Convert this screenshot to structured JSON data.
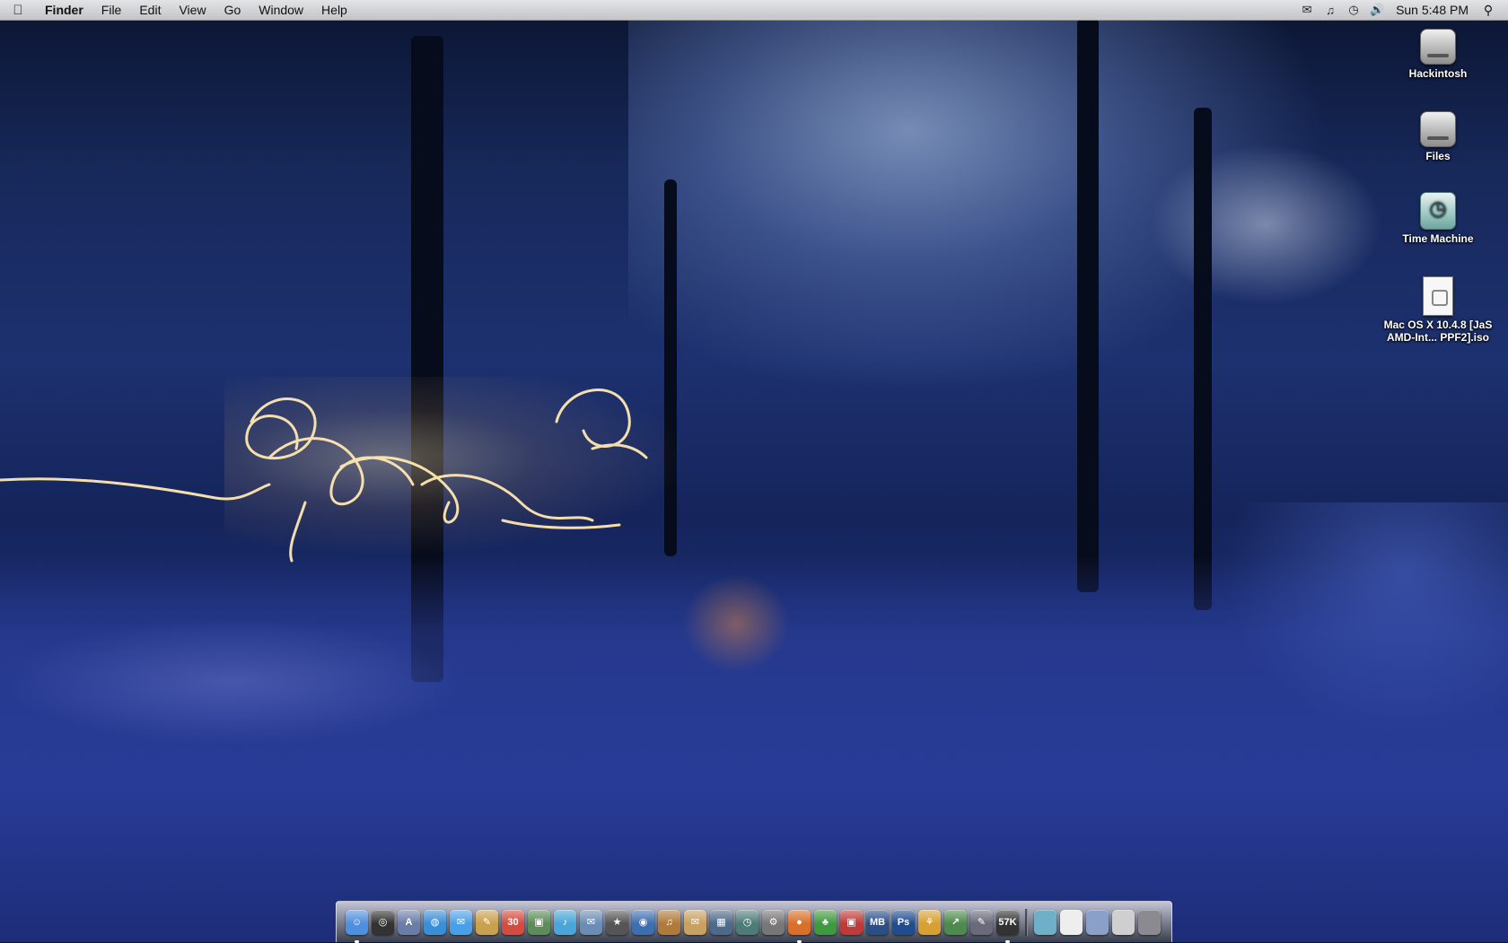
{
  "menubar": {
    "app_name": "Finder",
    "menus": [
      "File",
      "Edit",
      "View",
      "Go",
      "Window",
      "Help"
    ],
    "clock": "Sun 5:48 PM",
    "extras": [
      "mail-icon",
      "music-note-icon",
      "time-machine-icon",
      "volume-icon"
    ],
    "spotlight_icon": "spotlight-icon"
  },
  "desktop": {
    "icons": [
      {
        "label": "Hackintosh",
        "type": "disk"
      },
      {
        "label": "Files",
        "type": "disk"
      },
      {
        "label": "Time Machine",
        "type": "time-machine"
      },
      {
        "label": "Mac OS X 10.4.8 [JaS AMD-Int... PPF2].iso",
        "type": "iso"
      }
    ]
  },
  "dock": {
    "glyphs": [
      "☺",
      "◎",
      "A",
      "◍",
      "✉",
      "✎",
      "30",
      "▣",
      "♪",
      "✉",
      "★",
      "◉",
      "♫",
      "✉",
      "▦",
      "◷",
      "⚙",
      "●",
      "♣",
      "▣",
      "MB",
      "Ps",
      "⚘",
      "↗",
      "✎",
      "57K"
    ],
    "apps": [
      {
        "name": "Finder",
        "color": "#4d8fe0",
        "running": true
      },
      {
        "name": "Dashboard",
        "color": "#333",
        "running": false
      },
      {
        "name": "Preview",
        "color": "#6a7ca8",
        "running": false
      },
      {
        "name": "Safari",
        "color": "#3a8ed8",
        "running": false
      },
      {
        "name": "iChat",
        "color": "#4aa0e8",
        "running": false
      },
      {
        "name": "Address Book",
        "color": "#c9a04d",
        "running": false
      },
      {
        "name": "iCal",
        "color": "#d54b3f",
        "running": false
      },
      {
        "name": "iPhoto",
        "color": "#5d8c5a",
        "running": false
      },
      {
        "name": "iTunes",
        "color": "#4aa5d8",
        "running": false
      },
      {
        "name": "Mail",
        "color": "#6b8db5",
        "running": false
      },
      {
        "name": "Front Row",
        "color": "#555",
        "running": false
      },
      {
        "name": "DVD Player",
        "color": "#3d6fb0",
        "running": false
      },
      {
        "name": "GarageBand",
        "color": "#b07a3a",
        "running": false
      },
      {
        "name": "Mail Stamp",
        "color": "#c8a060",
        "running": false
      },
      {
        "name": "Spaces",
        "color": "#4d6a8a",
        "running": false
      },
      {
        "name": "Time Machine",
        "color": "#4d7c78",
        "running": false
      },
      {
        "name": "System Preferences",
        "color": "#777",
        "running": false
      },
      {
        "name": "Firefox",
        "color": "#d8702a",
        "running": true
      },
      {
        "name": "Adium",
        "color": "#3f9a3f",
        "running": false
      },
      {
        "name": "Parallels",
        "color": "#c03a3a",
        "running": false
      },
      {
        "name": "MB Tool",
        "color": "#2a4f88",
        "running": false
      },
      {
        "name": "Photoshop",
        "color": "#1f4d8f",
        "running": false
      },
      {
        "name": "Stickies",
        "color": "#d8a030",
        "running": false
      },
      {
        "name": "Grapher",
        "color": "#4d8a4d",
        "running": false
      },
      {
        "name": "Script Editor",
        "color": "#6a6a7a",
        "running": false
      },
      {
        "name": "Activity Monitor",
        "color": "#333",
        "running": true
      }
    ],
    "stacks": [
      {
        "name": "Applications stack",
        "color": "#6fb0c8"
      },
      {
        "name": "Documents stack",
        "color": "#eeeeee"
      },
      {
        "name": "Downloads stack",
        "color": "#8aa0c8"
      },
      {
        "name": "Pictures stack",
        "color": "#cfcfcf"
      },
      {
        "name": "Trash",
        "color": "#8a8a90"
      }
    ]
  }
}
